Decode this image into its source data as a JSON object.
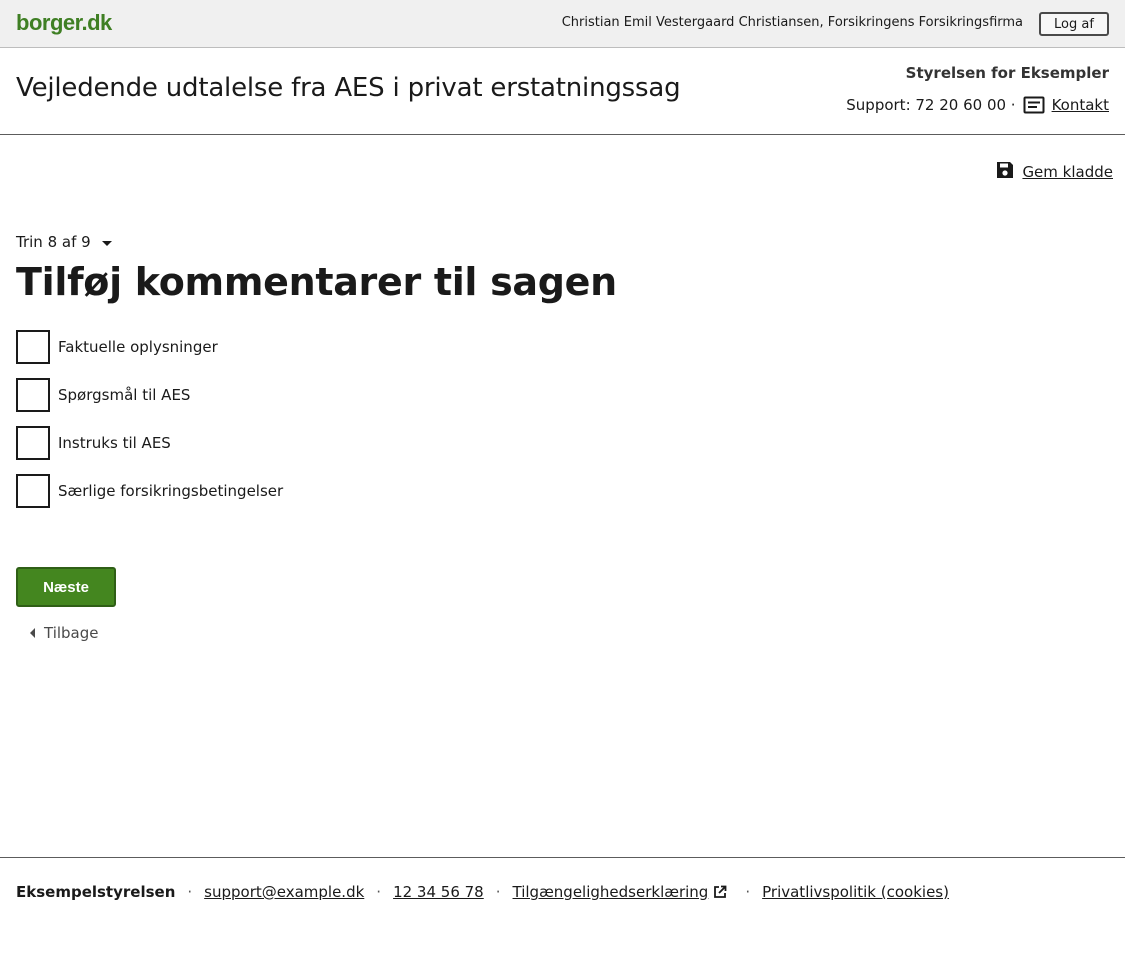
{
  "topbar": {
    "logo": "borger.dk",
    "user": "Christian Emil Vestergaard Christiansen, Forsikringens Forsikringsfirma",
    "logout_label": "Log af"
  },
  "header": {
    "title": "Vejledende udtalelse fra AES i privat erstatningssag",
    "authority": "Styrelsen for Eksempler",
    "support_text": "Support: 72 20 60 00 ·",
    "contact_label": "Kontakt",
    "contact_icon": "message-icon"
  },
  "save_draft": {
    "label": "Gem kladde",
    "icon": "floppy-disk-icon"
  },
  "step": {
    "label": "Trin 8 af 9",
    "icon": "caret-down-icon"
  },
  "page_heading": "Tilføj kommentarer til sagen",
  "checklist": [
    {
      "label": "Faktuelle oplysninger",
      "checked": false
    },
    {
      "label": "Spørgsmål til AES",
      "checked": false
    },
    {
      "label": "Instruks til AES",
      "checked": false
    },
    {
      "label": "Særlige forsikringsbetingelser",
      "checked": false
    }
  ],
  "actions": {
    "next_label": "Næste",
    "back_label": "Tilbage"
  },
  "footer": {
    "org": "Eksempelstyrelsen",
    "email": "support@example.dk",
    "phone": "12 34 56 78",
    "accessibility": "Tilgængelighedserklæring",
    "privacy": "Privatlivspolitik (cookies)",
    "separator": "·"
  },
  "colors": {
    "brand_green": "#44861f",
    "topbar_bg": "#f0f0f0"
  }
}
